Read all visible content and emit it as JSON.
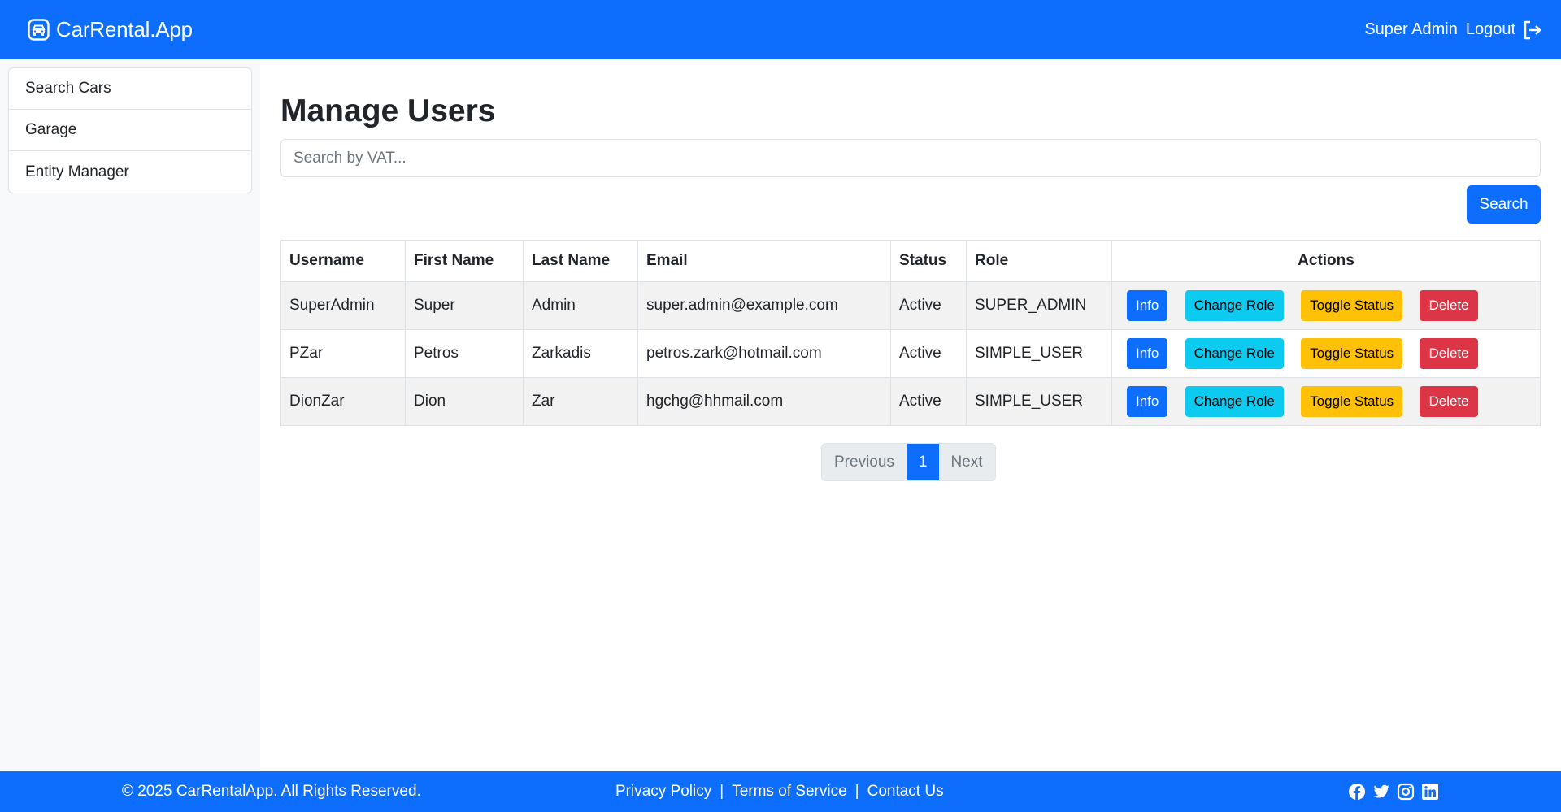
{
  "navbar": {
    "brand": "CarRental.App",
    "user_name": "Super Admin",
    "logout_label": "Logout"
  },
  "sidebar": {
    "items": [
      {
        "label": "Search Cars"
      },
      {
        "label": "Garage"
      },
      {
        "label": "Entity Manager"
      }
    ]
  },
  "main": {
    "title": "Manage Users",
    "search": {
      "placeholder": "Search by VAT...",
      "value": ""
    },
    "search_button": "Search",
    "table": {
      "headers": [
        "Username",
        "First Name",
        "Last Name",
        "Email",
        "Status",
        "Role",
        "Actions"
      ],
      "rows": [
        {
          "username": "SuperAdmin",
          "first_name": "Super",
          "last_name": "Admin",
          "email": "super.admin@example.com",
          "status": "Active",
          "role": "SUPER_ADMIN"
        },
        {
          "username": "PZar",
          "first_name": "Petros",
          "last_name": "Zarkadis",
          "email": "petros.zark@hotmail.com",
          "status": "Active",
          "role": "SIMPLE_USER"
        },
        {
          "username": "DionZar",
          "first_name": "Dion",
          "last_name": "Zar",
          "email": "hgchg@hhmail.com",
          "status": "Active",
          "role": "SIMPLE_USER"
        }
      ],
      "actions": {
        "info": "Info",
        "change_role": "Change Role",
        "toggle_status": "Toggle Status",
        "delete": "Delete"
      }
    },
    "pagination": {
      "previous": "Previous",
      "current_page": "1",
      "next": "Next"
    }
  },
  "footer": {
    "copyright": "© 2025 CarRentalApp. All Rights Reserved.",
    "links": [
      "Privacy Policy",
      "Terms of Service",
      "Contact Us"
    ],
    "separator": "|",
    "social_icons": [
      "facebook-icon",
      "twitter-icon",
      "instagram-icon",
      "linkedin-icon"
    ]
  },
  "colors": {
    "primary": "#0d6efd",
    "info": "#0dcaf0",
    "warning": "#ffc107",
    "danger": "#dc3545"
  }
}
